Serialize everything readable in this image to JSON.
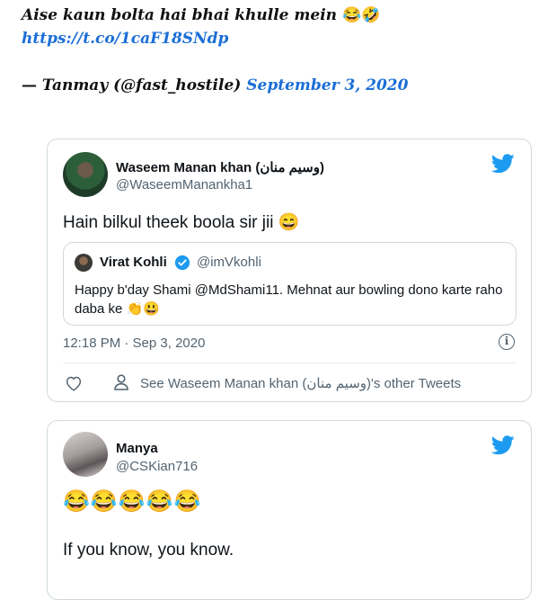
{
  "quote": {
    "line1": "Aise kaun bolta hai bhai khulle mein",
    "line1_emoji": "😂🤣",
    "link": "https://t.co/1caF18SNdp",
    "attribution": "— Tanmay (@fast_hostile)",
    "date": "September 3, 2020"
  },
  "tweet1": {
    "name": "Waseem Manan khan (وسيم منان)",
    "handle": "@WaseemManankha1",
    "text": "Hain bilkul theek boola sir jii",
    "text_emoji": "😄",
    "quoted": {
      "name": "Virat Kohli",
      "handle": "@imVkohli",
      "text": "Happy b'day Shami @MdShami11. Mehnat aur bowling dono karte raho daba ke",
      "text_emoji": "👏😃"
    },
    "timestamp": "12:18 PM · Sep 3, 2020",
    "other_tweets": "See Waseem Manan khan (وسيم منان)'s other Tweets"
  },
  "tweet2": {
    "name": "Manya",
    "handle": "@CSKian716",
    "emoji_line": "😂😂😂😂😂",
    "text": "If you know, you know."
  },
  "colors": {
    "twitter_blue": "#1d9bf0",
    "link_blue": "#1b6ed6",
    "muted_text": "#536471",
    "border": "#cfd9de"
  },
  "icons": [
    "twitter-bird-icon",
    "verified-badge-icon",
    "info-icon",
    "heart-icon",
    "person-icon"
  ]
}
